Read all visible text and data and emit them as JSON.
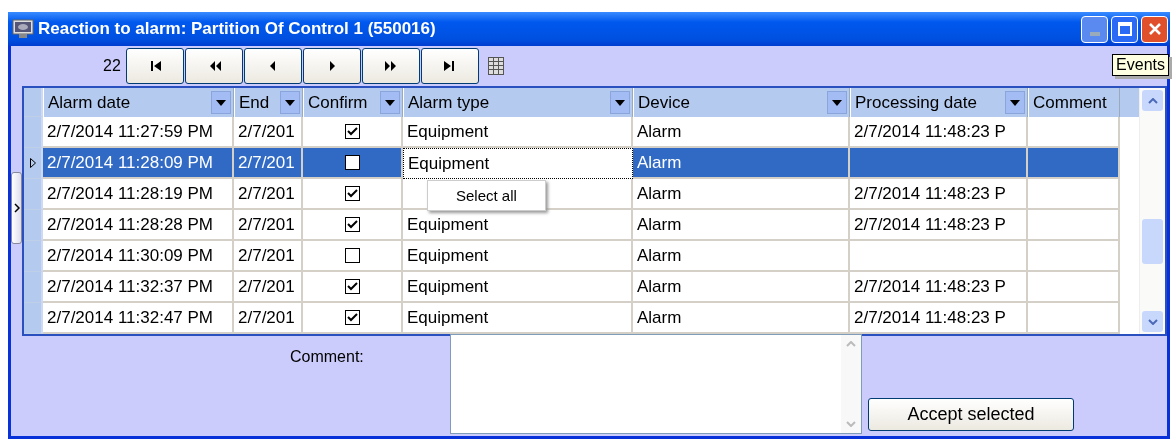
{
  "window": {
    "title": "Reaction to alarm: Partition Of Control 1 (550016)",
    "tooltip": "Events"
  },
  "navigator": {
    "count": "22",
    "buttons": [
      {
        "kind": "first"
      },
      {
        "kind": "fast-back"
      },
      {
        "kind": "back"
      },
      {
        "kind": "forward"
      },
      {
        "kind": "fast-forward"
      },
      {
        "kind": "last"
      }
    ]
  },
  "table": {
    "columns": [
      {
        "label": "Alarm date",
        "filter": true
      },
      {
        "label": "End",
        "filter": true
      },
      {
        "label": "Confirm",
        "filter": true
      },
      {
        "label": "Alarm type",
        "filter": true
      },
      {
        "label": "Device",
        "filter": true
      },
      {
        "label": "Processing date",
        "filter": true
      },
      {
        "label": "Comment",
        "filter": false
      }
    ],
    "rows": [
      {
        "selected": false,
        "alarm_date": "2/7/2014 11:27:59 PM",
        "end": "2/7/201",
        "checked": true,
        "alarm_type": "Equipment",
        "device": "Alarm",
        "processing_date": "2/7/2014 11:48:23 P"
      },
      {
        "selected": true,
        "alarm_date": "2/7/2014 11:28:09 PM",
        "end": "2/7/201",
        "checked": false,
        "alarm_type": "Equipment",
        "device": "Alarm"
      },
      {
        "selected": false,
        "alarm_date": "2/7/2014 11:28:19 PM",
        "end": "2/7/201",
        "checked": true,
        "device": "Alarm",
        "processing_date": "2/7/2014 11:48:23 P"
      },
      {
        "selected": false,
        "alarm_date": "2/7/2014 11:28:28 PM",
        "end": "2/7/201",
        "checked": true,
        "alarm_type": "Equipment",
        "device": "Alarm",
        "processing_date": "2/7/2014 11:48:23 P"
      },
      {
        "selected": false,
        "alarm_date": "2/7/2014 11:30:09 PM",
        "end": "2/7/201",
        "checked": false,
        "alarm_type": "Equipment",
        "device": "Alarm"
      },
      {
        "selected": false,
        "alarm_date": "2/7/2014 11:32:37 PM",
        "end": "2/7/201",
        "checked": true,
        "alarm_type": "Equipment",
        "device": "Alarm",
        "processing_date": "2/7/2014 11:48:23 P"
      },
      {
        "selected": false,
        "alarm_date": "2/7/2014 11:32:47 PM",
        "end": "2/7/201",
        "checked": true,
        "alarm_type": "Equipment",
        "device": "Alarm",
        "processing_date": "2/7/2014 11:48:23 P"
      }
    ]
  },
  "context_menu": {
    "items": [
      "Select all"
    ]
  },
  "comment": {
    "label": "Comment:"
  },
  "buttons": [
    "Accept selected"
  ]
}
